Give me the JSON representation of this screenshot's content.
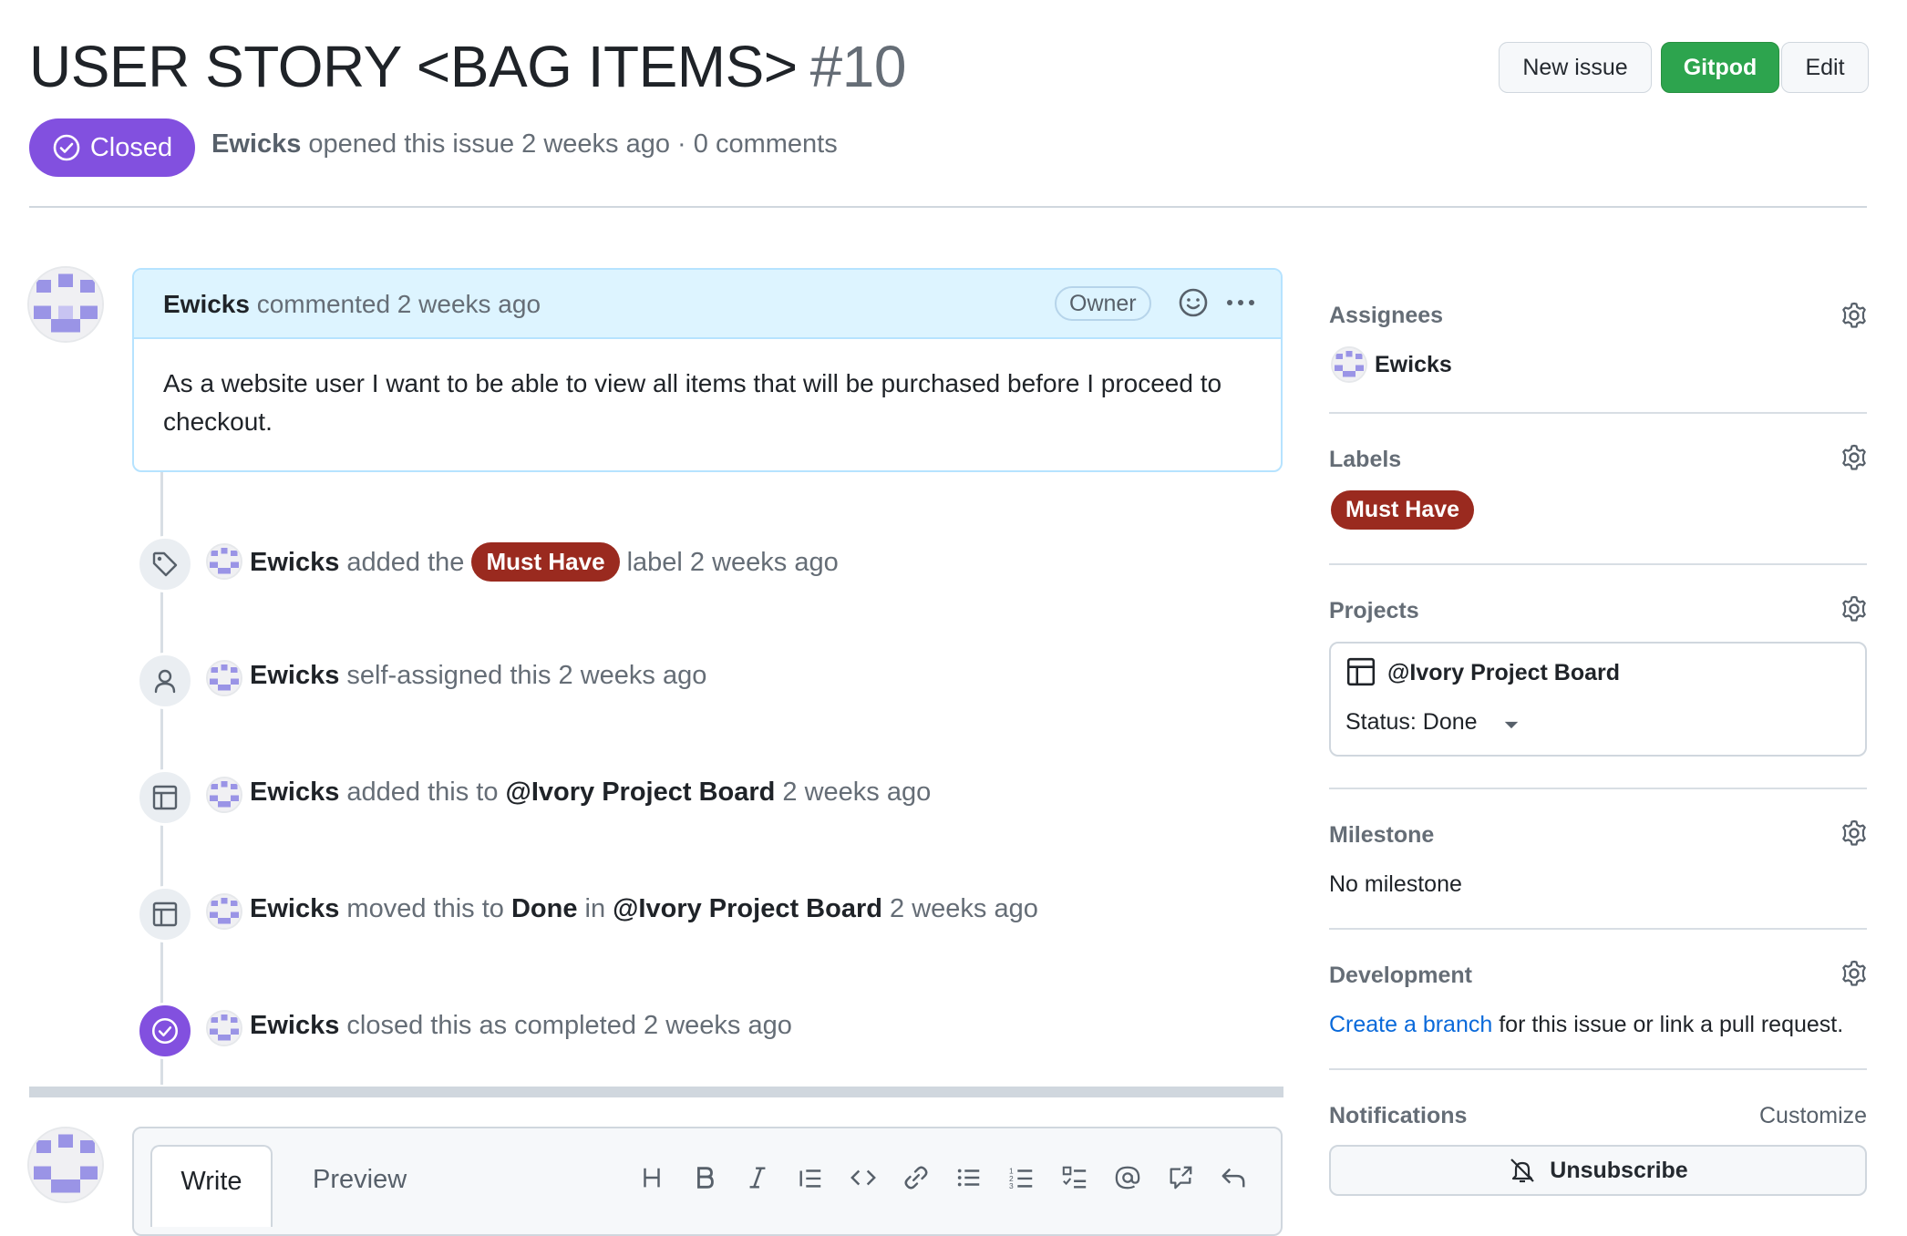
{
  "issue": {
    "title": "USER STORY <BAG ITEMS>",
    "number": "#10",
    "state": "Closed",
    "author": "Ewicks",
    "meta_text": "opened this issue 2 weeks ago · 0 comments"
  },
  "header_buttons": {
    "new_issue": "New issue",
    "gitpod": "Gitpod",
    "edit": "Edit"
  },
  "comment": {
    "author": "Ewicks",
    "action": "commented 2 weeks ago",
    "role_badge": "Owner",
    "body": "As a website user I want to be able to view all items that will be purchased before I proceed to checkout."
  },
  "timeline": {
    "e1": {
      "actor": "Ewicks",
      "pre": "added the",
      "label": "Must Have",
      "post": "label 2 weeks ago"
    },
    "e2": {
      "actor": "Ewicks",
      "text": "self-assigned this 2 weeks ago"
    },
    "e3": {
      "actor": "Ewicks",
      "pre": "added this to",
      "project": "@Ivory Project Board",
      "post": "2 weeks ago"
    },
    "e4": {
      "actor": "Ewicks",
      "pre": "moved this to",
      "status": "Done",
      "mid": "in",
      "project": "@Ivory Project Board",
      "post": "2 weeks ago"
    },
    "e5": {
      "actor": "Ewicks",
      "text": "closed this as completed 2 weeks ago"
    }
  },
  "editor": {
    "tab_write": "Write",
    "tab_preview": "Preview",
    "toolbar": [
      "heading-icon",
      "bold-icon",
      "italic-icon",
      "quote-icon",
      "code-icon",
      "link-icon",
      "bulleted-list-icon",
      "numbered-list-icon",
      "task-list-icon",
      "mention-icon",
      "cross-reference-icon",
      "reply-icon"
    ]
  },
  "sidebar": {
    "assignees": {
      "heading": "Assignees",
      "name": "Ewicks"
    },
    "labels": {
      "heading": "Labels",
      "label": "Must Have"
    },
    "projects": {
      "heading": "Projects",
      "board": "@Ivory Project Board",
      "status": "Status: Done"
    },
    "milestone": {
      "heading": "Milestone",
      "value": "No milestone"
    },
    "development": {
      "heading": "Development",
      "link": "Create a branch",
      "text": "for this issue or link a pull request."
    },
    "notifications": {
      "heading": "Notifications",
      "customize": "Customize",
      "button": "Unsubscribe"
    }
  },
  "colors": {
    "closed_purple": "#8250df",
    "label_red": "#9a2a1f",
    "gitpod_green": "#2da44e",
    "link_blue": "#0969da",
    "comment_header": "#ddf4ff"
  }
}
